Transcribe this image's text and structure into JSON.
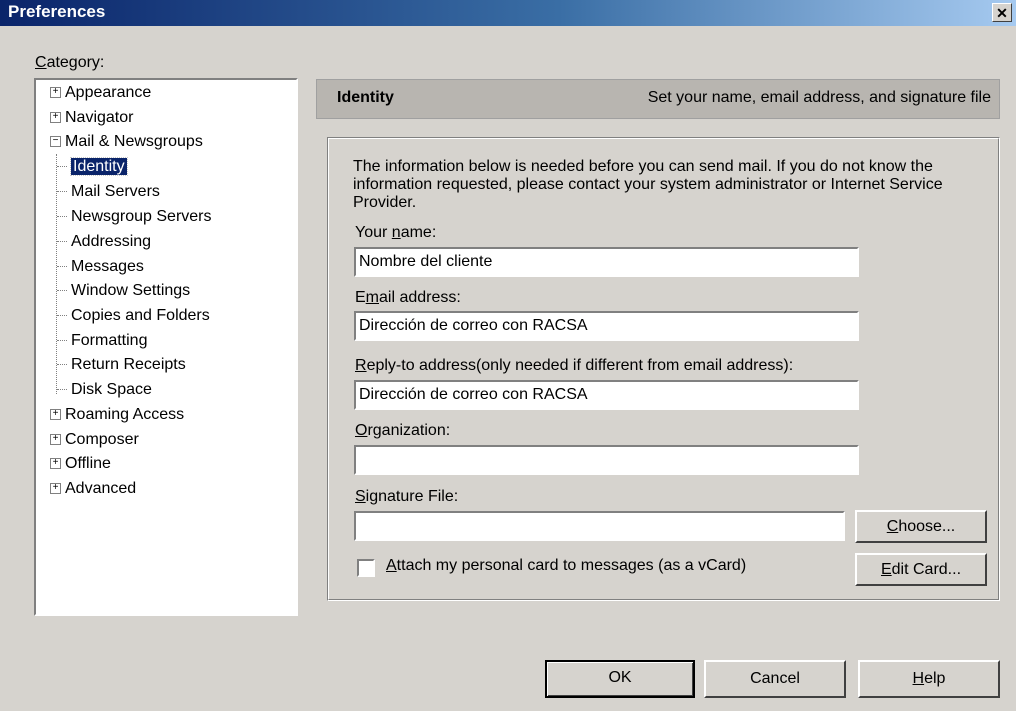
{
  "window": {
    "title": "Preferences",
    "close_glyph": "✕"
  },
  "category_label": "Category:",
  "tree": {
    "items": [
      {
        "label": "Appearance"
      },
      {
        "label": "Navigator"
      },
      {
        "label": "Mail & Newsgroups"
      },
      {
        "label": "Identity"
      },
      {
        "label": "Mail Servers"
      },
      {
        "label": "Newsgroup Servers"
      },
      {
        "label": "Addressing"
      },
      {
        "label": "Messages"
      },
      {
        "label": "Window Settings"
      },
      {
        "label": "Copies and Folders"
      },
      {
        "label": "Formatting"
      },
      {
        "label": "Return Receipts"
      },
      {
        "label": "Disk Space"
      },
      {
        "label": "Roaming Access"
      },
      {
        "label": "Composer"
      },
      {
        "label": "Offline"
      },
      {
        "label": "Advanced"
      }
    ],
    "expand_glyph": "+",
    "collapse_glyph": "−",
    "selected": "Identity"
  },
  "header": {
    "title": "Identity",
    "description": "Set your name, email address, and signature file"
  },
  "info_text": "The information below is needed before you can send mail.  If you do not know the information requested, please contact your system administrator or Internet Service Provider.",
  "fields": {
    "name": {
      "label_pre": "Your ",
      "label_u": "n",
      "label_post": "ame:",
      "value": "Nombre del cliente"
    },
    "email": {
      "label_pre": "E",
      "label_u": "m",
      "label_post": "ail address:",
      "value": "Dirección de correo con RACSA"
    },
    "reply_to": {
      "label_pre": "",
      "label_u": "R",
      "label_post": "eply-to address(only needed if different from email address):",
      "value": "Dirección de correo con RACSA"
    },
    "organization": {
      "label_pre": "",
      "label_u": "O",
      "label_post": "rganization:",
      "value": ""
    },
    "signature": {
      "label_pre": "",
      "label_u": "S",
      "label_post": "ignature File:",
      "value": ""
    }
  },
  "checkbox": {
    "label_u": "A",
    "label_post": "ttach my personal card to messages (as a vCard)",
    "checked": false
  },
  "buttons": {
    "choose": {
      "u": "C",
      "post": "hoose..."
    },
    "edit_card": {
      "u": "E",
      "post": "dit Card..."
    },
    "ok": "OK",
    "cancel": "Cancel",
    "help": {
      "u": "H",
      "post": "elp"
    }
  }
}
